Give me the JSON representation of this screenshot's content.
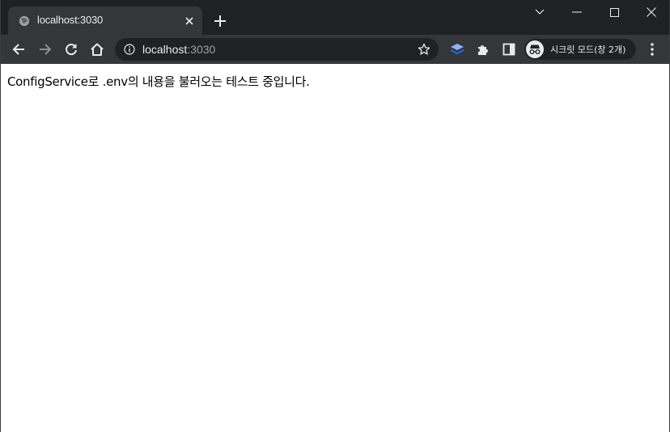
{
  "tab": {
    "title": "localhost:3030",
    "favicon": "globe-icon",
    "close": "close-icon"
  },
  "new_tab": "plus-icon",
  "window_controls": {
    "tab_search": "chevron-down-icon",
    "minimize": "minimize-icon",
    "maximize": "maximize-icon",
    "close": "close-icon"
  },
  "toolbar": {
    "back": "arrow-left-icon",
    "forward": "arrow-right-icon",
    "reload": "reload-icon",
    "home": "home-icon"
  },
  "omnibox": {
    "host": "localhost",
    "port": ":3030",
    "info_icon": "info-icon",
    "bookmark_icon": "star-icon"
  },
  "extensions": {
    "ext1": "layers-icon",
    "puzzle": "puzzle-icon",
    "side_panel": "side-panel-icon"
  },
  "incognito": {
    "label": "시크릿 모드(창 2개)",
    "icon": "incognito-icon"
  },
  "menu": "kebab-menu-icon",
  "page": {
    "text": "ConfigService로 .env의 내용을 불러오는 테스트 중입니다."
  },
  "colors": {
    "titlebar": "#202124",
    "toolbar": "#35363a",
    "text": "#e8eaed",
    "muted": "#9aa0a6"
  }
}
